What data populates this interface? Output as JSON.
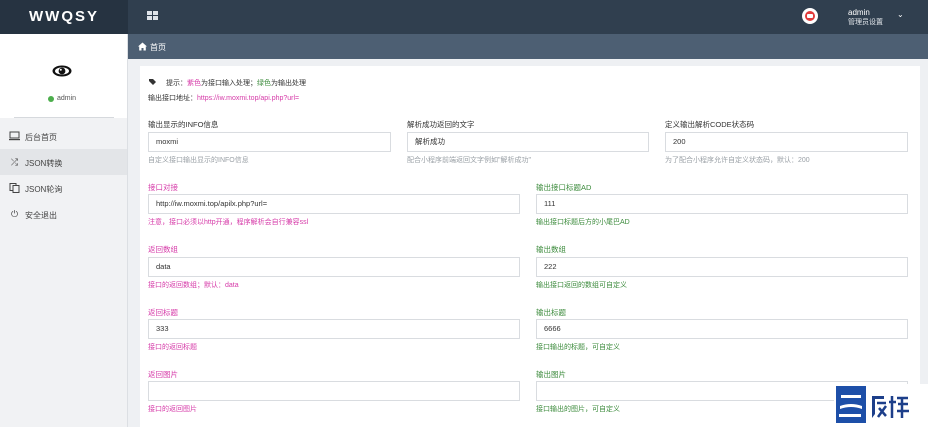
{
  "app": {
    "logo": "WWQSY"
  },
  "header": {
    "user_name": "admin",
    "user_role": "管理员设置"
  },
  "sidebar": {
    "profile_name": "admin",
    "items": [
      {
        "label": "后台首页",
        "icon": "monitor-icon"
      },
      {
        "label": "JSON转换",
        "icon": "shuffle-icon"
      },
      {
        "label": "JSON轮询",
        "icon": "copy-icon"
      },
      {
        "label": "安全退出",
        "icon": "power-icon"
      }
    ]
  },
  "breadcrumb": {
    "label": "首页"
  },
  "tips": {
    "prefix": "提示：",
    "purple_text": "紫色",
    "mid_text": "为接口输入处理；",
    "green_text": "绿色",
    "end_text": "为输出处理",
    "api_label": "输出接口地址：",
    "api_url": "https://iw.moxmi.top/api.php?url="
  },
  "form": {
    "info": {
      "label": "输出显示的INFO信息",
      "value": "moxmi",
      "hint": "自定义接口输出显示的INFO信息"
    },
    "success_text": {
      "label": "解析成功返回的文字",
      "value": "解析成功",
      "hint": "配合小程序前端返回文字例如\"解析成功\""
    },
    "code": {
      "label": "定义输出解析CODE状态码",
      "value": "200",
      "hint": "为了配合小程序允许自定义状态码，默认：200"
    },
    "api_in": {
      "label": "接口对接",
      "value": "http://iw.moxmi.top/apilx.php?url=",
      "hint": "注意，接口必须以http开通，程序解析会自行兼容ssl"
    },
    "ad": {
      "label": "输出接口标题AD",
      "value": "111",
      "hint": "输出接口标题后方的小尾巴AD"
    },
    "ret_array": {
      "label": "返回数组",
      "value": "data",
      "hint": "接口的返回数组；默认：data"
    },
    "out_array": {
      "label": "输出数组",
      "value": "222",
      "hint": "输出接口返回的数组可自定义"
    },
    "ret_title": {
      "label": "返回标题",
      "value": "333",
      "hint": "接口的返回标题"
    },
    "out_title": {
      "label": "输出标题",
      "value": "6666",
      "hint": "接口输出的标题，可自定义"
    },
    "ret_image": {
      "label": "返回图片",
      "value": "",
      "hint": "接口的返回图片"
    },
    "out_image": {
      "label": "输出图片",
      "value": "",
      "hint": "接口输出的图片，可自定义"
    }
  },
  "colors": {
    "topbar": "#303f4f",
    "breadcrumb": "#4d5f73",
    "input_purple": "#d63aa8",
    "output_green": "#3c8b3c"
  }
}
